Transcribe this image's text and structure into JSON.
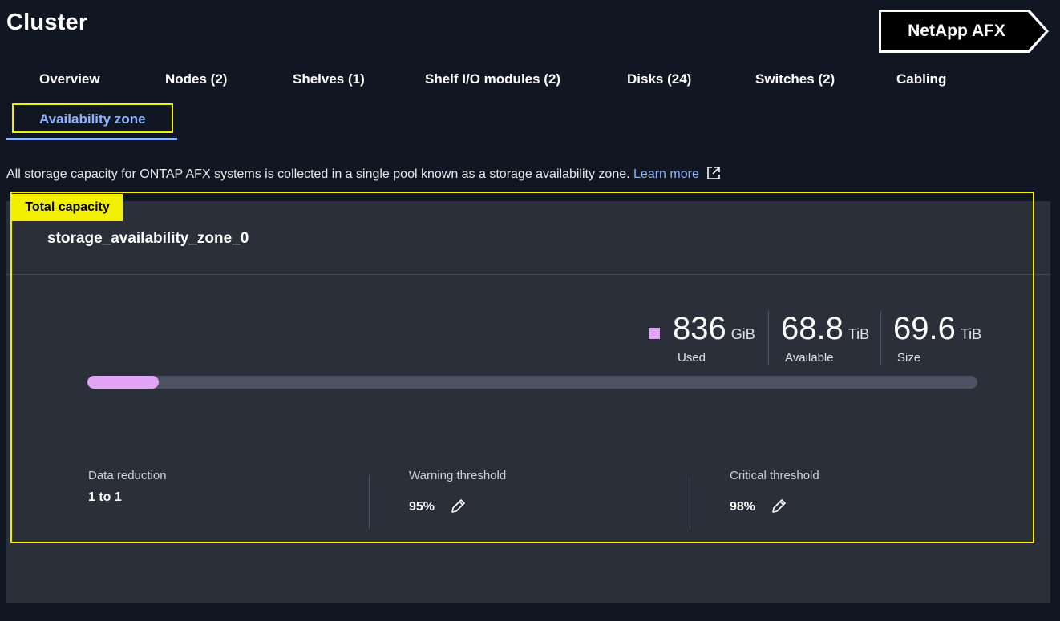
{
  "page": {
    "title": "Cluster"
  },
  "brand": {
    "label": "NetApp AFX"
  },
  "tabs": [
    {
      "label": "Overview"
    },
    {
      "label": "Nodes (2)"
    },
    {
      "label": "Shelves (1)"
    },
    {
      "label": "Shelf I/O modules (2)"
    },
    {
      "label": "Disks (24)"
    },
    {
      "label": "Switches (2)"
    },
    {
      "label": "Cabling"
    },
    {
      "label": "Availability zone",
      "active": true
    }
  ],
  "description": {
    "text": "All storage capacity for ONTAP AFX systems is collected in a single pool known as a storage availability zone.",
    "link": "Learn more"
  },
  "annotation": {
    "label": "Total capacity"
  },
  "zone": {
    "name": "storage_availability_zone_0",
    "used": {
      "value": "836",
      "unit": "GiB",
      "label": "Used"
    },
    "available": {
      "value": "68.8",
      "unit": "TiB",
      "label": "Available"
    },
    "size": {
      "value": "69.6",
      "unit": "TiB",
      "label": "Size"
    },
    "used_fraction": 0.08,
    "data_reduction": {
      "label": "Data reduction",
      "value": "1 to 1"
    },
    "warning_threshold": {
      "label": "Warning threshold",
      "value": "95%"
    },
    "critical_threshold": {
      "label": "Critical threshold",
      "value": "98%"
    }
  },
  "colors": {
    "used": "#e2a5f5",
    "accent": "#8fb3ff",
    "highlight": "#f2f000",
    "panel": "#2a2f3a"
  },
  "icons": [
    "external-link-icon",
    "pencil-icon"
  ]
}
